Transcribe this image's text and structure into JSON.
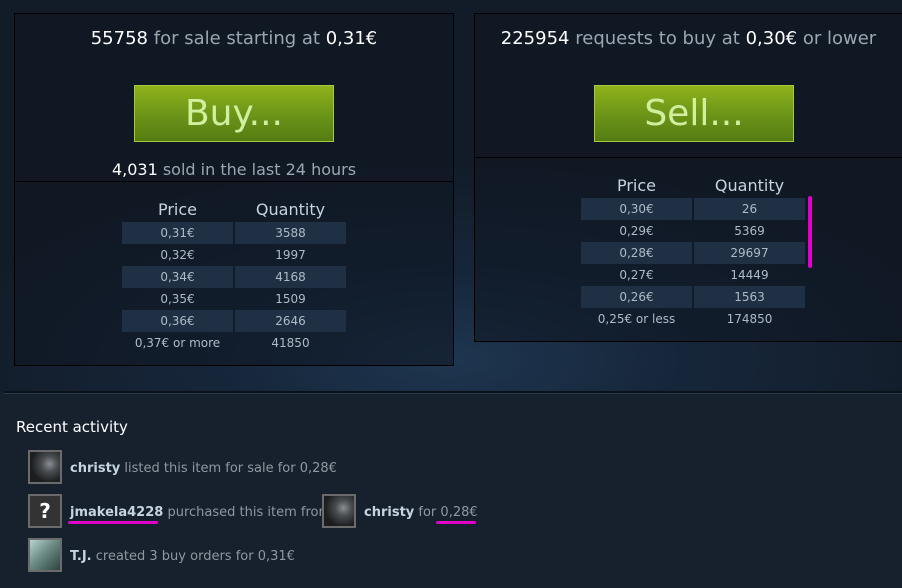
{
  "sell_panel": {
    "count": "55758",
    "text_mid": "for sale starting at",
    "price": "0,31€",
    "button_label": "Buy...",
    "sold_count": "4,031",
    "sold_text": "sold in the last 24 hours",
    "col_price": "Price",
    "col_qty": "Quantity",
    "rows": [
      {
        "price": "0,31€",
        "qty": "3588"
      },
      {
        "price": "0,32€",
        "qty": "1997"
      },
      {
        "price": "0,34€",
        "qty": "4168"
      },
      {
        "price": "0,35€",
        "qty": "1509"
      },
      {
        "price": "0,36€",
        "qty": "2646"
      },
      {
        "price": "0,37€ or more",
        "qty": "41850"
      }
    ]
  },
  "buy_panel": {
    "count": "225954",
    "text_mid": "requests to buy at",
    "price": "0,30€",
    "text_end": "or lower",
    "button_label": "Sell...",
    "col_price": "Price",
    "col_qty": "Quantity",
    "rows": [
      {
        "price": "0,30€",
        "qty": "26"
      },
      {
        "price": "0,29€",
        "qty": "5369"
      },
      {
        "price": "0,28€",
        "qty": "29697"
      },
      {
        "price": "0,27€",
        "qty": "14449"
      },
      {
        "price": "0,26€",
        "qty": "1563"
      },
      {
        "price": "0,25€ or less",
        "qty": "174850"
      }
    ]
  },
  "activity": {
    "title": "Recent activity",
    "items": [
      {
        "user": "christy",
        "text": "listed this item for sale for 0,28€"
      },
      {
        "buyer": "jmakela4228",
        "text_mid": "purchased this item from",
        "seller": "christy",
        "for_text": "for",
        "price": "0,28€"
      },
      {
        "user": "T.J.",
        "text": "created 3 buy orders for 0,31€"
      }
    ]
  },
  "colors": {
    "button_green": "#6a9318",
    "annotation_magenta": "#e000c8",
    "background": "#17212e"
  }
}
